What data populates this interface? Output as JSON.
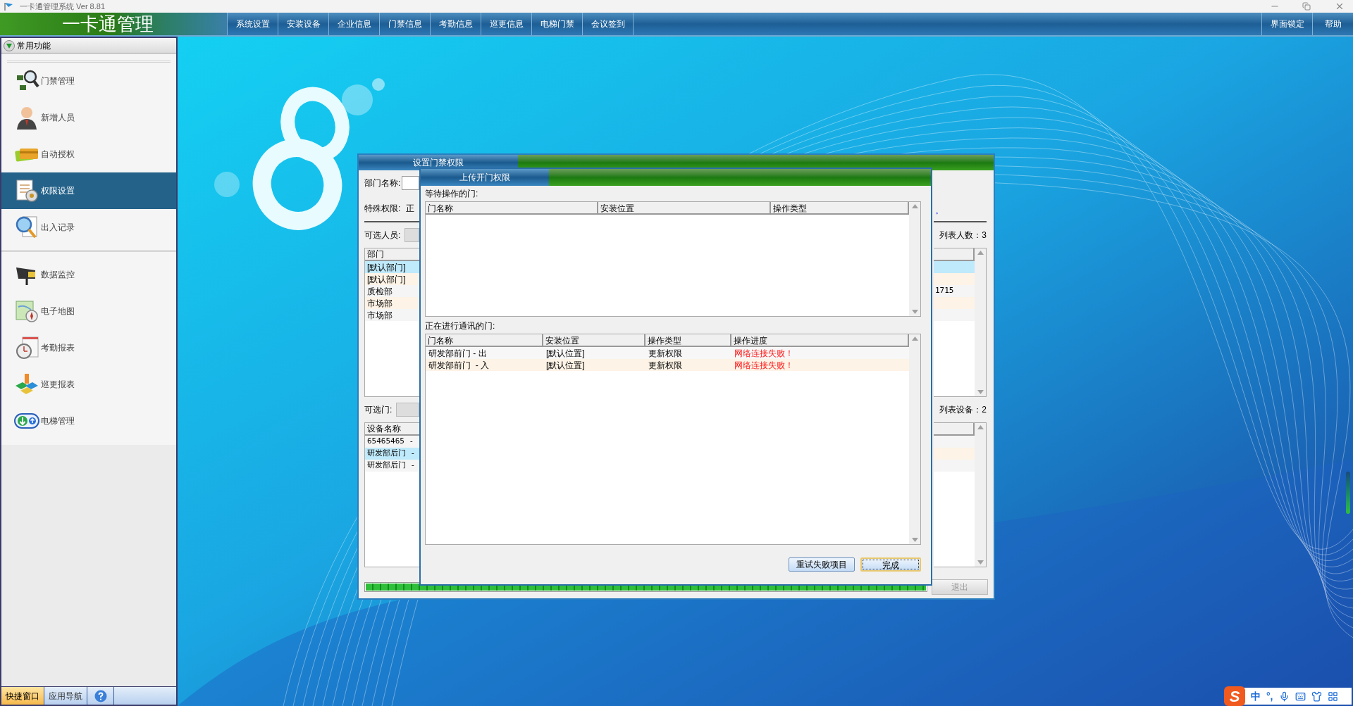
{
  "window": {
    "title": "一卡通管理系统 Ver 8.81"
  },
  "header": {
    "app_name": "一卡通管理",
    "menu": [
      "系统设置",
      "安装设备",
      "企业信息",
      "门禁信息",
      "考勤信息",
      "巡更信息",
      "电梯门禁",
      "会议签到"
    ],
    "right_menu": [
      "界面锁定",
      "帮助"
    ]
  },
  "sidebar": {
    "title": "常用功能",
    "expanded": true,
    "groups": [
      [
        {
          "label": "门禁管理",
          "selected": false
        },
        {
          "label": "新增人员",
          "selected": false
        },
        {
          "label": "自动授权",
          "selected": false
        },
        {
          "label": "权限设置",
          "selected": true
        },
        {
          "label": "出入记录",
          "selected": false
        }
      ],
      [
        {
          "label": "数据监控",
          "selected": false
        },
        {
          "label": "电子地图",
          "selected": false
        },
        {
          "label": "考勤报表",
          "selected": false
        },
        {
          "label": "巡更报表",
          "selected": false
        },
        {
          "label": "电梯管理",
          "selected": false
        }
      ]
    ],
    "bottom_tabs": [
      {
        "label": "快捷窗口",
        "selected": true
      },
      {
        "label": "应用导航",
        "selected": false
      }
    ]
  },
  "back_dialog": {
    "title": "设置门禁权限",
    "dept_label": "部门名称:",
    "special_label": "特殊权限:",
    "special_value": "正",
    "note_tail": "。",
    "people_label": "可选人员:",
    "people_count": "列表人数：3",
    "people_header": "部门",
    "people_rows": [
      {
        "dept": "[默认部门]",
        "selected": true
      },
      {
        "dept": "[默认部门]",
        "selected": false
      },
      {
        "dept": "质检部",
        "selected": false,
        "column_tail": "1715"
      },
      {
        "dept": "市场部",
        "selected": false
      },
      {
        "dept": "市场部",
        "selected": false
      }
    ],
    "doors_label": "可选门:",
    "doors_count": "列表设备：2",
    "doors_header": "设备名称",
    "doors_rows": [
      {
        "name": "65465465 -",
        "selected": false
      },
      {
        "name": "研发部后门 -",
        "selected": true
      },
      {
        "name": "研发部后门 -",
        "selected": false
      }
    ],
    "progress": {
      "level": 1
    },
    "exit_button": {
      "label": "退出",
      "disabled": true
    }
  },
  "front_dialog": {
    "title": "上传开门权限",
    "waiting_label": "等待操作的门:",
    "waiting_columns": [
      "门名称",
      "安装位置",
      "操作类型"
    ],
    "active_label": "正在进行通讯的门:",
    "active_columns": [
      "门名称",
      "安装位置",
      "操作类型",
      "操作进度"
    ],
    "active_rows": [
      {
        "cells": [
          "研发部前门 - 出",
          "[默认位置]",
          "更新权限",
          "网络连接失败！"
        ],
        "error": true
      },
      {
        "cells": [
          "研发部前门  - 入",
          "[默认位置]",
          "更新权限",
          "网络连接失败！"
        ],
        "error": true
      }
    ],
    "buttons": [
      {
        "label": "重试失败项目",
        "focused": false
      },
      {
        "label": "完成",
        "focused": true
      }
    ]
  },
  "ime": {
    "logo": "S",
    "mode": "中",
    "punct": "°,"
  }
}
